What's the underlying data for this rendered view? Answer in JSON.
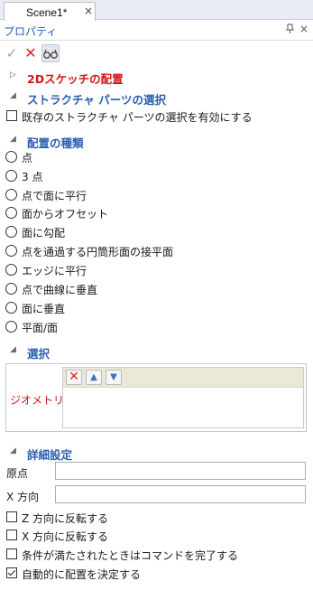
{
  "tab": {
    "title": "Scene1*",
    "close": "×"
  },
  "panel": {
    "title": "プロパティ",
    "pin": "⊣",
    "close": "×"
  },
  "toolbar": {
    "ok": "✓",
    "cancel": "✕"
  },
  "sections": {
    "sketch": {
      "arrow": "▷",
      "title": "2Dスケッチの配置"
    },
    "structure": {
      "arrow": "◢",
      "title": "ストラクチャ パーツの選択",
      "checkbox": {
        "label": "既存のストラクチャ パーツの選択を有効にする",
        "checked": false
      }
    },
    "placement": {
      "arrow": "◢",
      "title": "配置の種類",
      "options": [
        "点",
        "3 点",
        "点で面に平行",
        "面からオフセット",
        "面に勾配",
        "点を通過する円筒形面の接平面",
        "エッジに平行",
        "点で曲線に垂直",
        "面に垂直",
        "平面/面"
      ]
    },
    "selection": {
      "arrow": "◢",
      "title": "選択",
      "geometry_label": "ジオメトリ",
      "buttons": {
        "delete": "✕",
        "up": "▲",
        "down": "▼"
      }
    },
    "advanced": {
      "arrow": "◢",
      "title": "詳細設定",
      "origin_label": "原点",
      "origin_value": "",
      "xdir_label": "X 方向",
      "xdir_value": "",
      "checkboxes": [
        {
          "label": "Z 方向に反転する",
          "checked": false
        },
        {
          "label": "X 方向に反転する",
          "checked": false
        },
        {
          "label": "条件が満たされたときはコマンドを完了する",
          "checked": false
        },
        {
          "label": "自動的に配置を決定する",
          "checked": true
        }
      ]
    }
  }
}
